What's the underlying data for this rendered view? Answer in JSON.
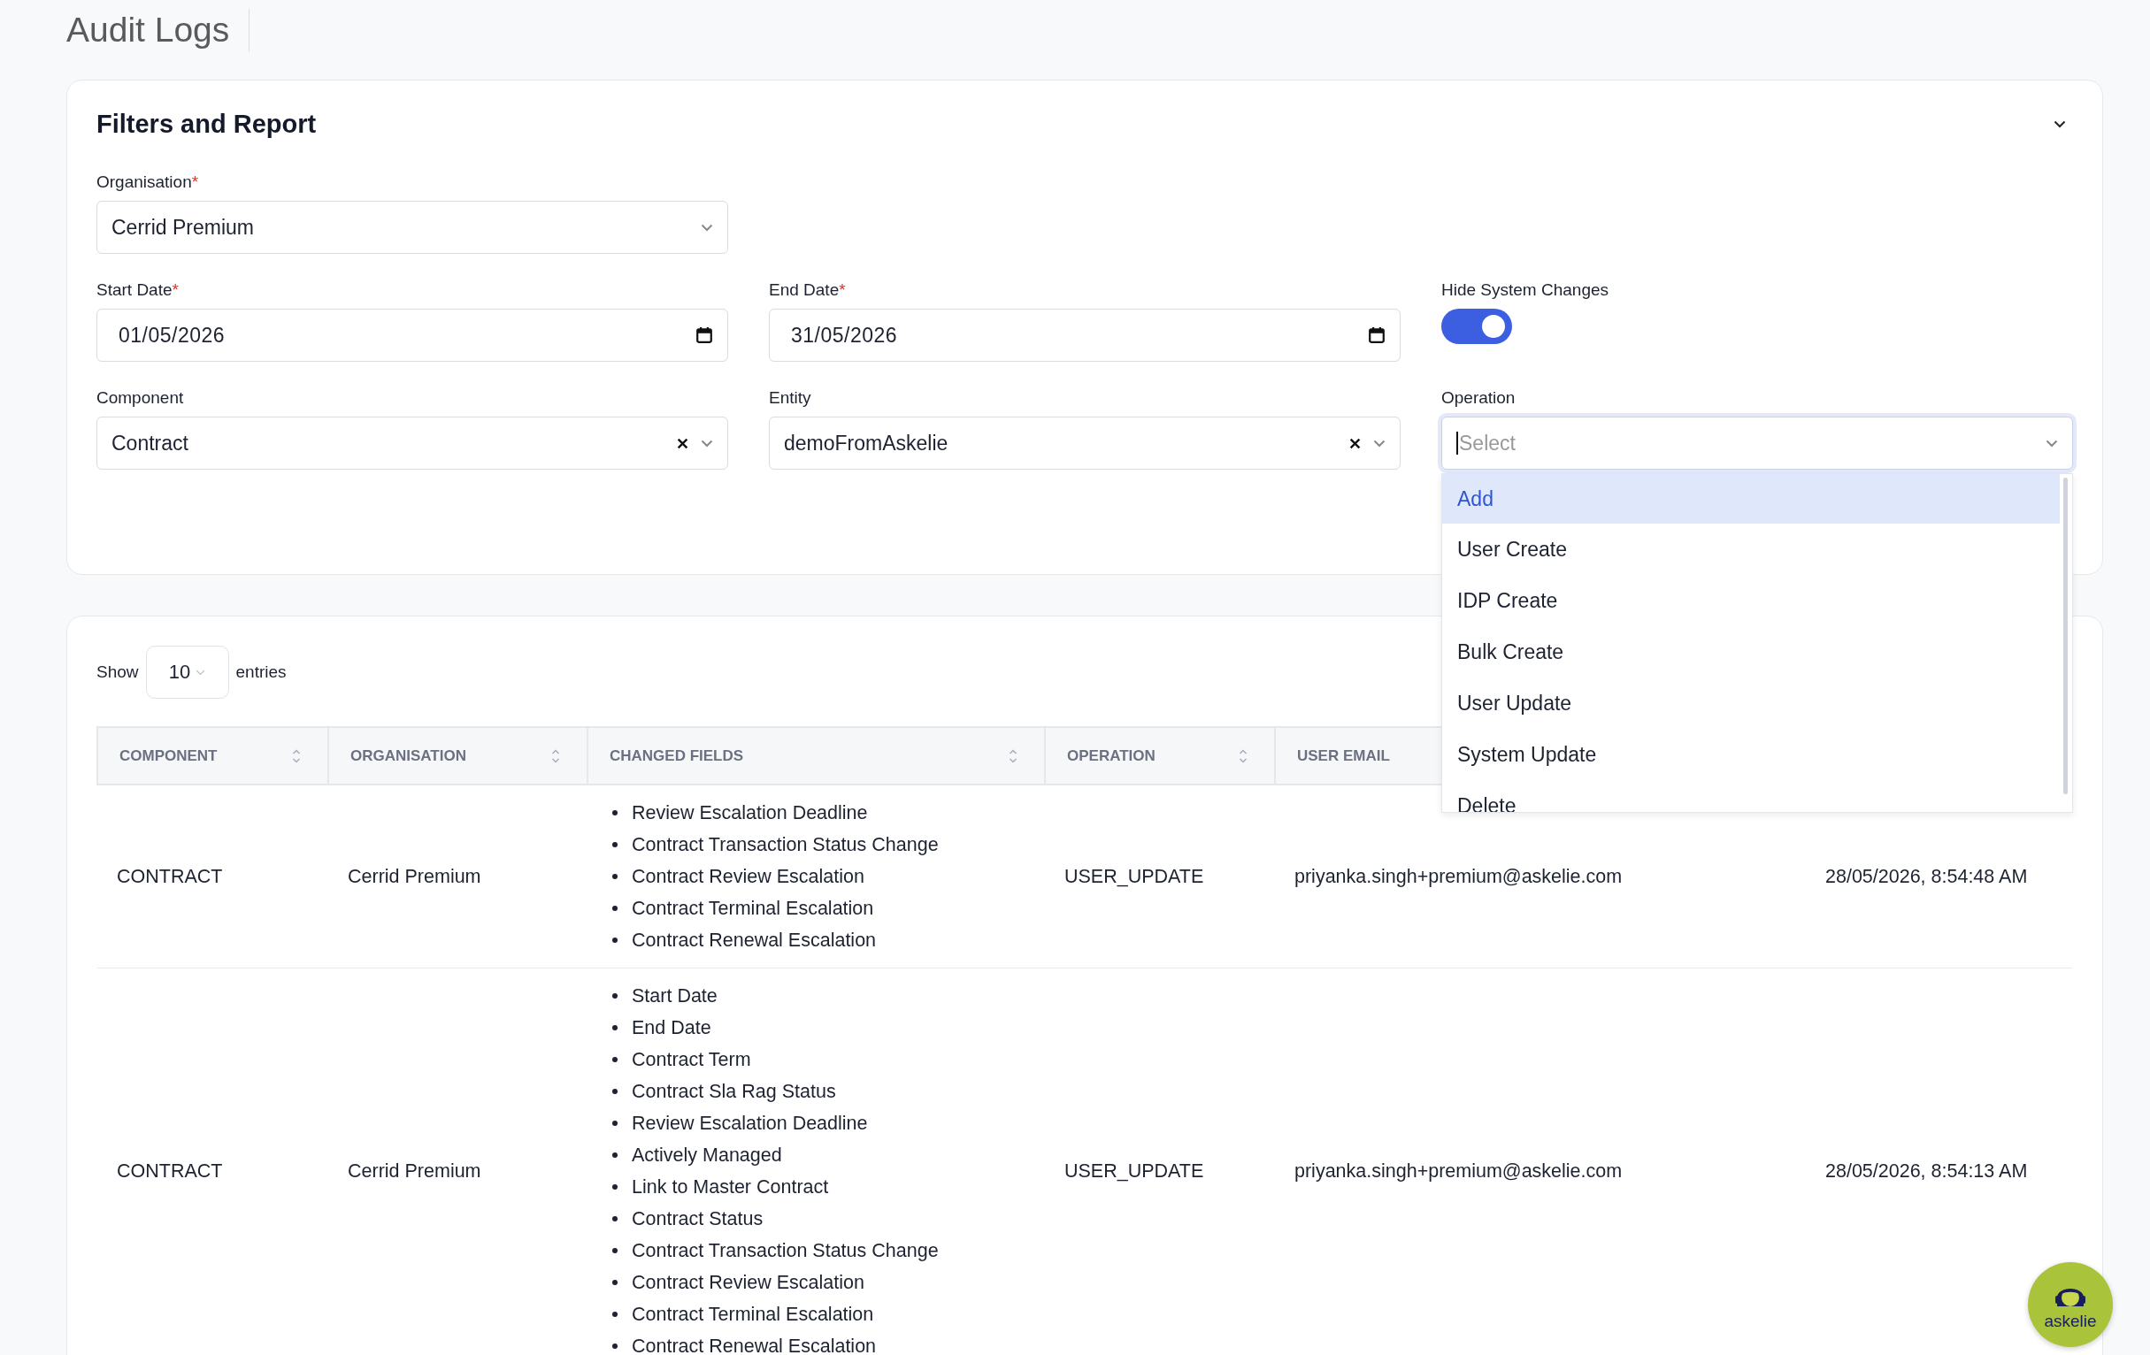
{
  "page_title": "Audit Logs",
  "filters_card": {
    "title": "Filters and Report",
    "expanded": true,
    "rows": [
      [
        {
          "kind": "select",
          "label": "Organisation",
          "required_mark": "*",
          "value": "Cerrid Premium",
          "clearable": false,
          "focused": false
        }
      ],
      [
        {
          "kind": "date",
          "label": "Start Date",
          "required_mark": "*",
          "value": "01/05/2026",
          "focused": false
        },
        {
          "kind": "date",
          "label": "End Date",
          "required_mark": "*",
          "value": "31/05/2026",
          "focused": false
        },
        {
          "kind": "toggle",
          "label": "Hide System Changes",
          "on": true
        }
      ],
      [
        {
          "kind": "select",
          "label": "Component",
          "value": "Contract",
          "clearable": true,
          "focused": false
        },
        {
          "kind": "select",
          "label": "Entity",
          "value": "demoFromAskelie",
          "clearable": true,
          "focused": false
        },
        {
          "kind": "select",
          "label": "Operation",
          "placeholder": "Select",
          "clearable": false,
          "focused": true,
          "options": [
            {
              "label": "Add",
              "selected": true
            },
            {
              "label": "User Create",
              "selected": false
            },
            {
              "label": "IDP Create",
              "selected": false
            },
            {
              "label": "Bulk Create",
              "selected": false
            },
            {
              "label": "User Update",
              "selected": false
            },
            {
              "label": "System Update",
              "selected": false
            },
            {
              "label": "Delete",
              "selected": false
            }
          ]
        }
      ]
    ]
  },
  "entries": {
    "before": "Show",
    "value": "10",
    "after": "entries"
  },
  "table": {
    "columns": [
      {
        "label": "COMPONENT",
        "sortable": true
      },
      {
        "label": "ORGANISATION",
        "sortable": true
      },
      {
        "label": "CHANGED FIELDS",
        "sortable": true
      },
      {
        "label": "OPERATION",
        "sortable": true
      },
      {
        "label": "USER EMAIL"
      }
    ],
    "rows": [
      {
        "component": "CONTRACT",
        "organisation": "Cerrid Premium",
        "changed_fields": [
          "Review Escalation Deadline",
          "Contract Transaction Status Change",
          "Contract Review Escalation",
          "Contract Terminal Escalation",
          "Contract Renewal Escalation"
        ],
        "operation": "USER_UPDATE",
        "user_email": "priyanka.singh+premium@askelie.com",
        "timestamp": "28/05/2026, 8:54:48 AM"
      },
      {
        "component": "CONTRACT",
        "organisation": "Cerrid Premium",
        "changed_fields": [
          "Start Date",
          "End Date",
          "Contract Term",
          "Contract Sla Rag Status",
          "Review Escalation Deadline",
          "Actively Managed",
          "Link to Master Contract",
          "Contract Status",
          "Contract Transaction Status Change",
          "Contract Review Escalation",
          "Contract Terminal Escalation",
          "Contract Renewal Escalation"
        ],
        "operation": "USER_UPDATE",
        "user_email": "priyanka.singh+premium@askelie.com",
        "timestamp": "28/05/2026, 8:54:13 AM"
      }
    ]
  },
  "chat_widget": {
    "label": "askelie"
  }
}
